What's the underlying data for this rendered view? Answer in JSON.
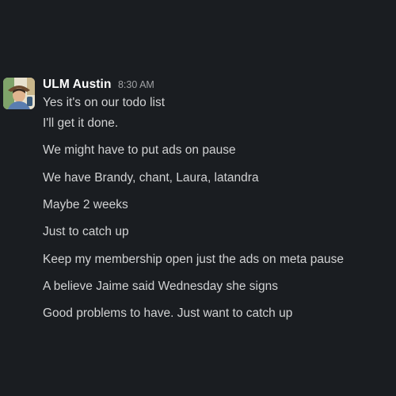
{
  "message": {
    "author": "ULM Austin",
    "timestamp": "8:30 AM",
    "lines": [
      "Yes it's on our todo list",
      "I'll get it done.",
      "We might have to put ads on pause",
      "We have Brandy, chant, Laura, latandra",
      "Maybe 2 weeks",
      "Just to catch up",
      "Keep my membership open just the ads on meta pause",
      "A believe Jaime said Wednesday she signs",
      "Good problems to have. Just want to catch up"
    ]
  }
}
